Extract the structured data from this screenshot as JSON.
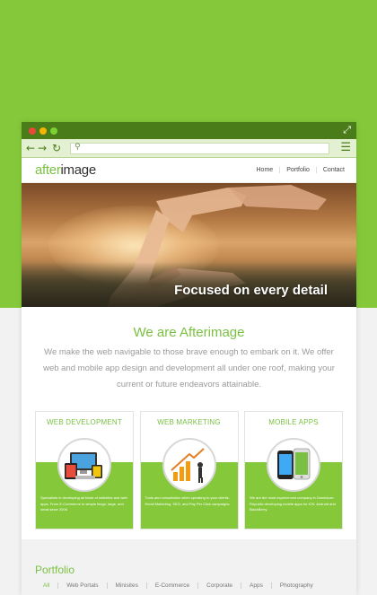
{
  "browser": {
    "expand_icon": "expand-icon",
    "back_icon": "arrow-left-icon",
    "forward_icon": "arrow-right-icon",
    "reload_icon": "reload-icon",
    "search_icon": "search-icon",
    "menu_icon": "hamburger-menu-icon",
    "address": ""
  },
  "site": {
    "logo_prefix": "after",
    "logo_suffix": "image",
    "nav": [
      "Home",
      "Portfolio",
      "Contact"
    ]
  },
  "hero": {
    "title": "Focused on every detail"
  },
  "intro": {
    "heading_prefix": "We are ",
    "heading_brand": "Afterimage",
    "text": "We make the web navigable to those brave enough to embark on it. We offer web and mobile app design and development all under one roof, making your current or future endeavors attainable."
  },
  "services": [
    {
      "title": "WEB DEVELOPMENT",
      "text": "Specialists in developing all kinds of websites and web apps. From E-Commerce to simple blogs, large, and small since 2006."
    },
    {
      "title": "WEB MARKETING",
      "text": "Tools and consultation when speaking to your clients. Email Marketing, SEO, and Pay Per Click campaigns."
    },
    {
      "title": "MOBILE APPS",
      "text": "We are the most experienced company in Dominican Republic developing mobile apps for iOS, Android and BlackBerry."
    }
  ],
  "portfolio": {
    "title": "Portfolio",
    "filters": [
      "All",
      "Web Portals",
      "Minisites",
      "E-Commerce",
      "Corporate",
      "Apps",
      "Photography"
    ],
    "active_filter": "All"
  },
  "colors": {
    "brand_green": "#7ac143",
    "background_green": "#85c93a",
    "titlebar_green": "#4a7d1a"
  }
}
